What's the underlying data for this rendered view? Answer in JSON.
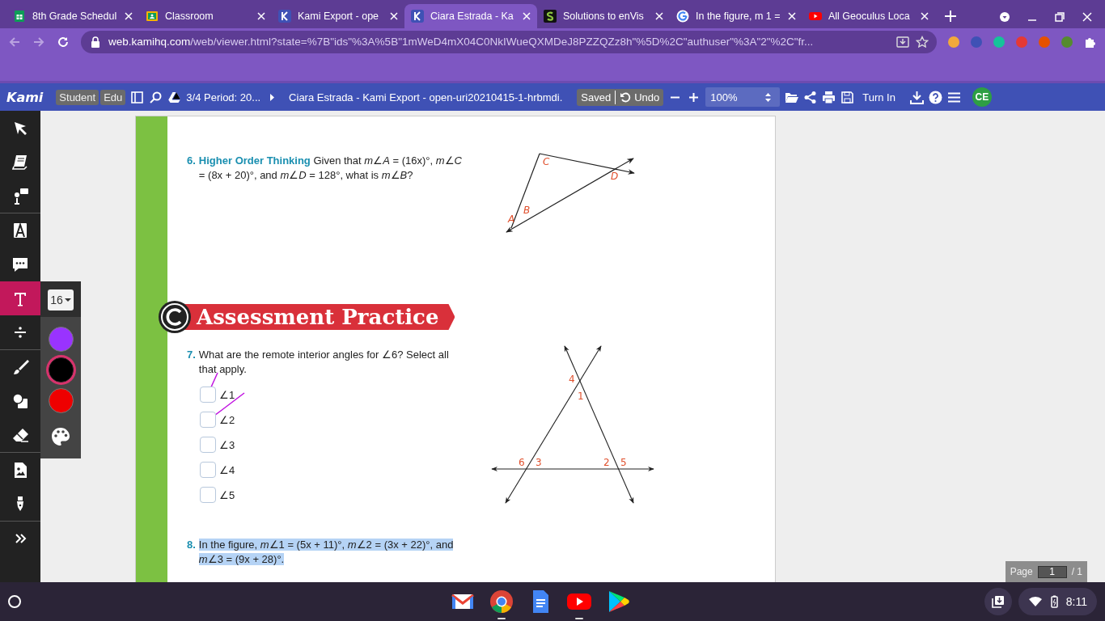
{
  "browser": {
    "tabs": [
      {
        "kind": "sheets",
        "title": "8th Grade Schedul",
        "selected": false
      },
      {
        "kind": "classroom",
        "title": "Classroom",
        "selected": false
      },
      {
        "kind": "kami",
        "title": "Kami Export - ope",
        "selected": false
      },
      {
        "kind": "kami",
        "title": "Ciara Estrada - Ka",
        "selected": true
      },
      {
        "kind": "slader",
        "title": "Solutions to enVis",
        "selected": false
      },
      {
        "kind": "google",
        "title": "In the figure, m 1 =",
        "selected": false
      },
      {
        "kind": "youtube",
        "title": "All Geoculus Loca",
        "selected": false
      }
    ],
    "address": {
      "host": "web.kamihq.com",
      "path": "/web/viewer.html?state=%7B\"ids\"%3A%5B\"1mWeD4mX04C0NkIWueQXMDeJ8PZZQZz8h\"%5D%2C\"authuser\"%3A\"2\"%2C\"fr..."
    },
    "extensions": [
      {
        "color": "#f2a93b"
      },
      {
        "color": "#3f51b5"
      },
      {
        "color": "#15c39a"
      },
      {
        "color": "#e53935"
      },
      {
        "color": "#e65100"
      },
      {
        "color": "#558b2f"
      }
    ]
  },
  "kami_toolbar": {
    "logo": "Kami",
    "badges": [
      "Student",
      "Edu"
    ],
    "folder": "3/4 Period: 20...",
    "document": "Ciara Estrada - Kami Export - open-uri20210415-1-hrbmdi.",
    "saved": "Saved",
    "undo": "Undo",
    "zoom": "100%",
    "turn_in": "Turn In",
    "avatar": "CE"
  },
  "tool_groups": [
    [
      {
        "kind": "select",
        "selected": false
      },
      {
        "kind": "book",
        "selected": false
      },
      {
        "kind": "speech",
        "selected": false
      }
    ],
    [
      {
        "kind": "textbox",
        "selected": false
      },
      {
        "kind": "comment",
        "selected": false
      },
      {
        "kind": "text",
        "selected": true
      },
      {
        "kind": "equation",
        "selected": false
      }
    ],
    [
      {
        "kind": "brush",
        "selected": false
      },
      {
        "kind": "shapes",
        "selected": false
      },
      {
        "kind": "eraser",
        "selected": false
      }
    ],
    [
      {
        "kind": "image",
        "selected": false
      },
      {
        "kind": "signature",
        "selected": false
      }
    ],
    [
      {
        "kind": "expand",
        "selected": false
      }
    ]
  ],
  "text_options": {
    "font_size": "16",
    "colors": [
      {
        "color": "#9933ff",
        "selected": false
      },
      {
        "color": "#000000",
        "selected": true
      },
      {
        "color": "#ee0000",
        "selected": false
      }
    ]
  },
  "document": {
    "q6": {
      "number": "6.",
      "text": "**Higher Order Thinking**  Given that *m*∠*A* = (16x)°, *m*∠*C* = (8x + 20)°, and *m*∠*D* = 128°, what is *m*∠*B*?",
      "figure_labels": [
        "C",
        "D",
        "A",
        "B"
      ]
    },
    "banner": "Assessment Practice",
    "q7": {
      "number": "7.",
      "text": "What are the remote interior angles for ∠6? Select all that apply.",
      "options": [
        {
          "label": "∠1",
          "checked": false
        },
        {
          "label": "∠2",
          "checked": false
        },
        {
          "label": "∠3",
          "checked": false
        },
        {
          "label": "∠4",
          "checked": false
        },
        {
          "label": "∠5",
          "checked": false
        }
      ],
      "figure_labels": [
        "4",
        "1",
        "6",
        "3",
        "2",
        "5"
      ]
    },
    "q8": {
      "number": "8.",
      "text": "In the figure, *m*∠1 = (5x + 11)°, *m*∠2 = (3x + 22)°, and *m*∠3 = (9x + 28)°.",
      "highlighted": true
    }
  },
  "page_indicator": {
    "label": "Page",
    "current": "1",
    "total": "/ 1"
  },
  "taskbar": {
    "apps": [
      {
        "kind": "gmail",
        "selected": false
      },
      {
        "kind": "chrome",
        "selected": true
      },
      {
        "kind": "docs",
        "selected": false
      },
      {
        "kind": "youtube",
        "selected": true
      },
      {
        "kind": "play",
        "selected": false
      }
    ],
    "time": "8:11"
  }
}
